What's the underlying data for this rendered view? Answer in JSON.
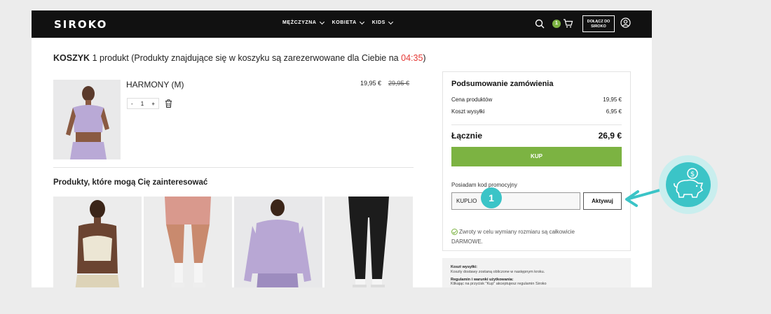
{
  "header": {
    "logo": "SIROKO",
    "nav": [
      {
        "label": "MĘŻCZYZNA"
      },
      {
        "label": "KOBIETA"
      },
      {
        "label": "KIDS"
      }
    ],
    "cart_count": "1",
    "join_label_line1": "DOŁĄCZ DO",
    "join_label_line2": "SIROKO"
  },
  "cart": {
    "title_strong": "KOSZYK",
    "title_count": "1 produkt",
    "title_note": "(Produkty znajdujące się w koszyku są zarezerwowane dla Ciebie na",
    "timer": "04:35",
    "title_close": ")",
    "item": {
      "name": "HARMONY (M)",
      "price": "19,95 €",
      "old_price": "29,95 €",
      "quantity": "1",
      "minus": "-",
      "plus": "+"
    }
  },
  "recommendations": {
    "title": "Produkty, które mogą Cię zainteresować"
  },
  "summary": {
    "title": "Podsumowanie zamówienia",
    "products_label": "Cena produktów",
    "products_value": "19,95 €",
    "shipping_label": "Koszt wysyłki",
    "shipping_value": "6,95 €",
    "total_label": "Łącznie",
    "total_value": "26,9 €",
    "buy_label": "KUP",
    "promo_label": "Posiadam kod promocyjny",
    "promo_value": "KUPLIO",
    "promo_button": "Aktywuj",
    "returns_line1": "Zwroty w celu wymiany rozmiaru są całkowicie",
    "returns_line2": "DARMOWE."
  },
  "annotation": {
    "step": "1",
    "color": "#3bc4c7"
  },
  "info": {
    "shipping_title": "Koszt wysyłki:",
    "shipping_text": "Koszty dostawy zostaną obliczone w następnym kroku.",
    "terms_title": "Regulamin i warunki użytkowania:",
    "terms_text": "Klikając na przycisk \"Kup\" akceptujesz regulamin Siroko"
  },
  "colors": {
    "accent_green": "#7cb342",
    "timer_red": "#e53935",
    "topbar": "#111111"
  }
}
